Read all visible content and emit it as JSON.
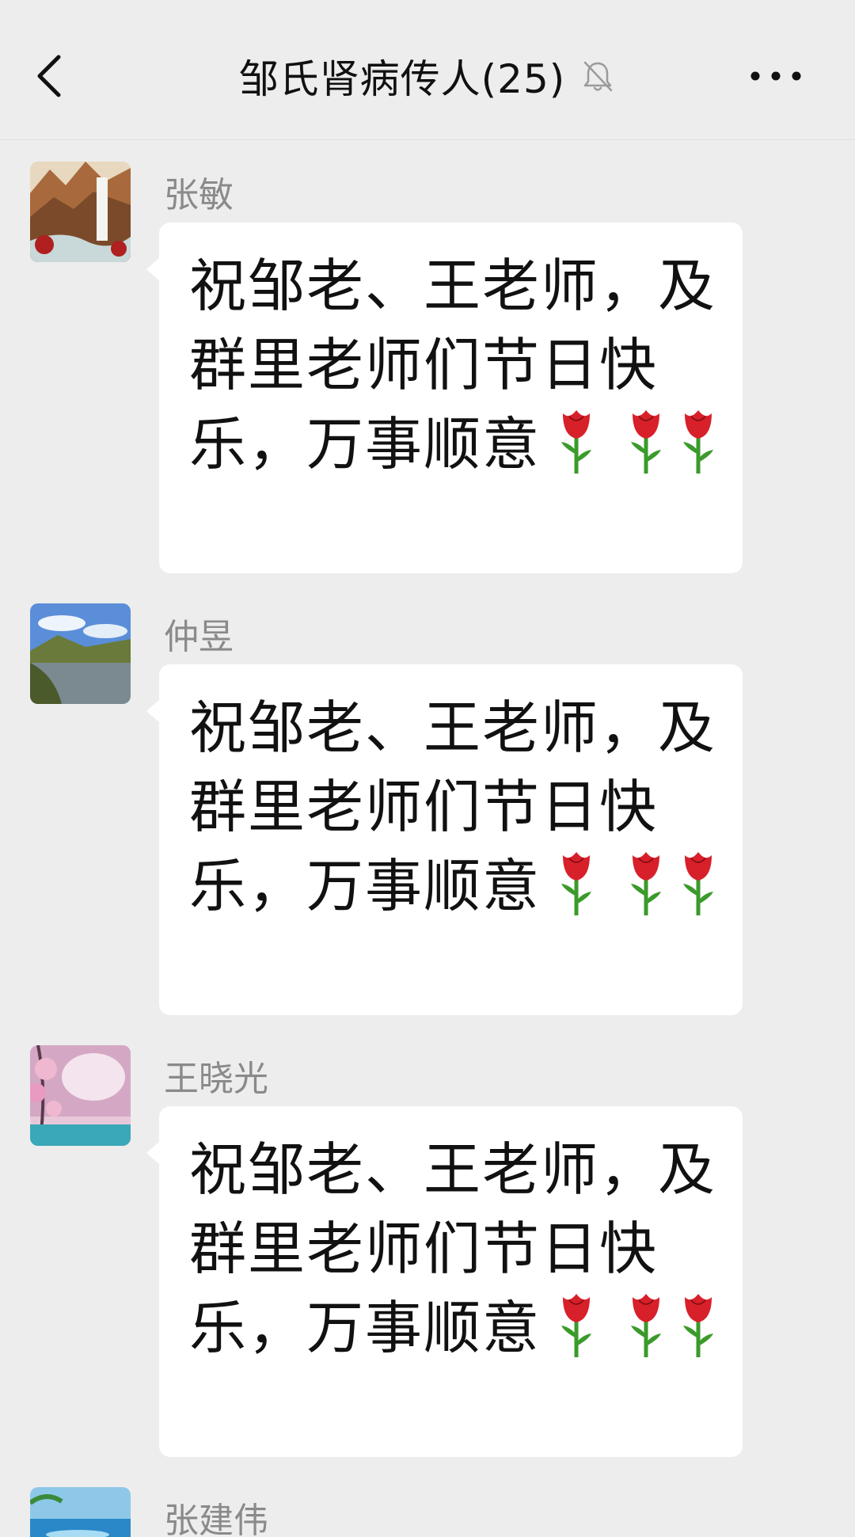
{
  "header": {
    "title": "邹氏肾病传人(25)",
    "back_icon": "chevron-left-icon",
    "mute_icon": "bell-off-icon",
    "more_icon": "more-dots-icon"
  },
  "messages": [
    {
      "sender": "张敏",
      "text": "祝邹老、王老师，及群里老师们节日快乐，万事顺意",
      "emoji": "rose",
      "emoji_count": 3
    },
    {
      "sender": "仲昱",
      "text": "祝邹老、王老师，及群里老师们节日快乐，万事顺意",
      "emoji": "rose",
      "emoji_count": 3
    },
    {
      "sender": "王晓光",
      "text": "祝邹老、王老师，及群里老师们节日快乐，万事顺意",
      "emoji": "rose",
      "emoji_count": 3
    },
    {
      "sender": "张建伟"
    }
  ],
  "colors": {
    "background": "#ededed",
    "bubble": "#ffffff",
    "sender_name": "#8a8a8a",
    "text": "#111111",
    "rose_red": "#d8202a",
    "stem_green": "#3a9a2a"
  }
}
